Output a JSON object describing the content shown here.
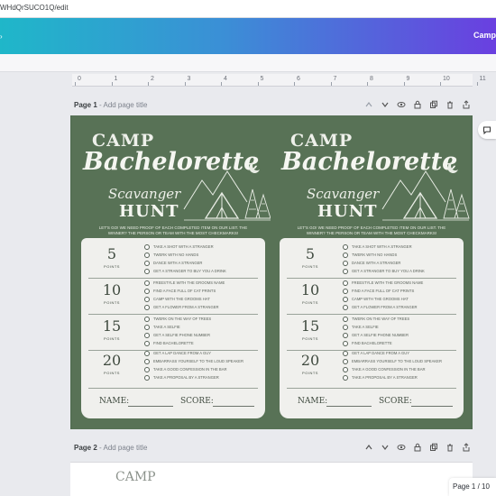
{
  "browser": {
    "url_fragment": "WHdQrSUCO1Q/edit"
  },
  "topbar": {
    "brand_text": "Camp"
  },
  "ruler": {
    "ticks": [
      "0",
      "1",
      "2",
      "3",
      "4",
      "5",
      "6",
      "7",
      "8",
      "9",
      "10",
      "11"
    ]
  },
  "pages": [
    {
      "label": "Page 1",
      "add_title": "- Add page title"
    },
    {
      "label": "Page 2",
      "add_title": "- Add page title"
    }
  ],
  "design": {
    "title_line1": "CAMP",
    "title_line2": "Bachelorette",
    "title_line3": "Scavanger",
    "title_line4": "HUNT",
    "tagline": "LET'S GO!  WE NEED PROOF OF EACH COMPLETED ITEM ON OUR LIST. THE WINNER? THE PERSON OR TEAM WITH THE MOST CHECKMARKS!",
    "tiers": [
      {
        "points": "5",
        "points_label": "POINTS",
        "items": [
          "TAKE A SHOT WITH A STRANGER",
          "TWERK WITH NO HANDS",
          "DANCE WITH A STRANGER",
          "GET A STRANGER TO BUY YOU A DRINK"
        ]
      },
      {
        "points": "10",
        "points_label": "POINTS",
        "items": [
          "FREESTYLE WITH THE GROOMS NAME",
          "FIND A FACE FULL OF CAT PRINTS",
          "CAMP WITH THE GROOMS HAT",
          "GET A FLOWER FROM A STRANGER"
        ]
      },
      {
        "points": "15",
        "points_label": "POINTS",
        "items": [
          "TWERK ON THE WAY OF TREES",
          "TAKE A SELFIE",
          "GET A SELFIE PHONE NUMBER",
          "FIND BACHELORETTE"
        ]
      },
      {
        "points": "20",
        "points_label": "POINTS",
        "items": [
          "GET A LAP DANCE FROM A GUY",
          "EMBARRASS YOURSELF TO THE LOUD SPEAKER",
          "TAKE A GOOD CONFESSION IN THE BAR",
          "TAKE A PROPOSAL BY A STRANGER"
        ]
      }
    ],
    "footer_name": "NAME:",
    "footer_score": "SCORE:"
  },
  "page2_peek": "CAMP",
  "pager": {
    "text": "Page 1 / 10"
  },
  "colors": {
    "card_green": "#587256",
    "panel": "#f0f0ed",
    "accent_gradient_start": "#1fb7c9",
    "accent_gradient_end": "#6a3fe0"
  },
  "icons": [
    "chevron-up-icon",
    "chevron-down-icon",
    "eye-icon",
    "lock-icon",
    "duplicate-icon",
    "trash-icon",
    "share-icon",
    "comment-icon"
  ]
}
